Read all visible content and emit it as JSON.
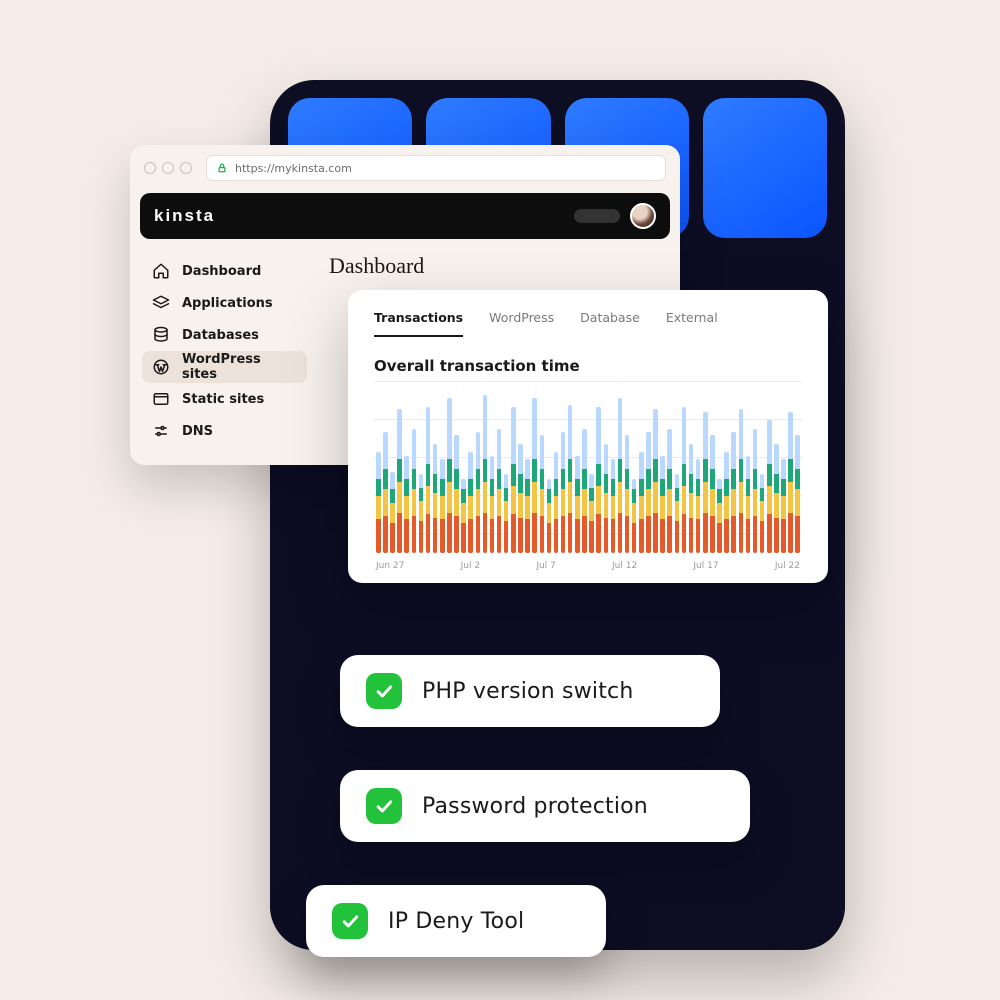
{
  "browser": {
    "url": "https://mykinsta.com"
  },
  "brand": "kinsta",
  "sidebar": {
    "items": [
      {
        "label": "Dashboard",
        "icon": "home",
        "active": false
      },
      {
        "label": "Applications",
        "icon": "layers",
        "active": false
      },
      {
        "label": "Databases",
        "icon": "database",
        "active": false
      },
      {
        "label": "WordPress sites",
        "icon": "wordpress",
        "active": true
      },
      {
        "label": "Static sites",
        "icon": "browser",
        "active": false
      },
      {
        "label": "DNS",
        "icon": "sliders",
        "active": false
      }
    ]
  },
  "page": {
    "title": "Dashboard"
  },
  "chart": {
    "tabs": [
      {
        "label": "Transactions",
        "active": true
      },
      {
        "label": "WordPress",
        "active": false
      },
      {
        "label": "Database",
        "active": false
      },
      {
        "label": "External",
        "active": false
      }
    ],
    "title": "Overall transaction time",
    "x_ticks": [
      "Jun 27",
      "Jul 2",
      "Jul 7",
      "Jul 12",
      "Jul 17",
      "Jul 22"
    ]
  },
  "chart_data": {
    "type": "bar",
    "stacked": true,
    "title": "Overall transaction time",
    "xlabel": "",
    "ylabel": "",
    "ylim": [
      0,
      100
    ],
    "x_ticks": [
      "Jun 27",
      "Jul 2",
      "Jul 7",
      "Jul 12",
      "Jul 17",
      "Jul 22"
    ],
    "series_order": [
      "orange",
      "yellow",
      "green",
      "light_blue"
    ],
    "colors": {
      "orange": "#e45a2a",
      "yellow": "#f4c545",
      "green": "#1ea87a",
      "light_blue": "#b9d8ff"
    },
    "n_bars": 60,
    "note": "Values are approximate percentages of max bar height estimated from the image; one stacked bar per day.",
    "series": [
      {
        "name": "orange",
        "values": [
          20,
          22,
          18,
          24,
          20,
          22,
          19,
          23,
          21,
          20,
          24,
          22,
          18,
          20,
          22,
          24,
          20,
          22,
          19,
          23,
          21,
          20,
          24,
          22,
          18,
          20,
          22,
          24,
          20,
          22,
          19,
          23,
          21,
          20,
          24,
          22,
          18,
          20,
          22,
          24,
          20,
          22,
          19,
          23,
          21,
          20,
          24,
          22,
          18,
          20,
          22,
          24,
          20,
          22,
          19,
          23,
          21,
          20,
          24,
          22
        ]
      },
      {
        "name": "yellow",
        "values": [
          14,
          16,
          12,
          18,
          14,
          16,
          12,
          17,
          15,
          14,
          18,
          16,
          12,
          14,
          16,
          18,
          14,
          16,
          12,
          17,
          15,
          14,
          18,
          16,
          12,
          14,
          16,
          18,
          14,
          16,
          12,
          17,
          15,
          14,
          18,
          16,
          12,
          14,
          16,
          18,
          14,
          16,
          12,
          17,
          15,
          14,
          18,
          16,
          12,
          14,
          16,
          18,
          14,
          16,
          12,
          17,
          15,
          14,
          18,
          16
        ]
      },
      {
        "name": "green",
        "values": [
          10,
          12,
          8,
          14,
          10,
          12,
          8,
          13,
          11,
          10,
          14,
          12,
          8,
          10,
          12,
          14,
          10,
          12,
          8,
          13,
          11,
          10,
          14,
          12,
          8,
          10,
          12,
          14,
          10,
          12,
          8,
          13,
          11,
          10,
          14,
          12,
          8,
          10,
          12,
          14,
          10,
          12,
          8,
          13,
          11,
          10,
          14,
          12,
          8,
          10,
          12,
          14,
          10,
          12,
          8,
          13,
          11,
          10,
          14,
          12
        ]
      },
      {
        "name": "light_blue",
        "values": [
          16,
          22,
          10,
          30,
          14,
          24,
          8,
          34,
          18,
          12,
          36,
          20,
          6,
          16,
          22,
          38,
          14,
          24,
          8,
          34,
          18,
          12,
          36,
          20,
          6,
          16,
          22,
          32,
          14,
          24,
          8,
          34,
          18,
          12,
          36,
          20,
          6,
          16,
          22,
          30,
          14,
          24,
          8,
          34,
          18,
          12,
          28,
          20,
          6,
          16,
          22,
          30,
          14,
          24,
          8,
          26,
          18,
          12,
          28,
          20
        ]
      }
    ]
  },
  "features": [
    {
      "label": "PHP version switch"
    },
    {
      "label": "Password protection"
    },
    {
      "label": "IP Deny Tool"
    }
  ]
}
